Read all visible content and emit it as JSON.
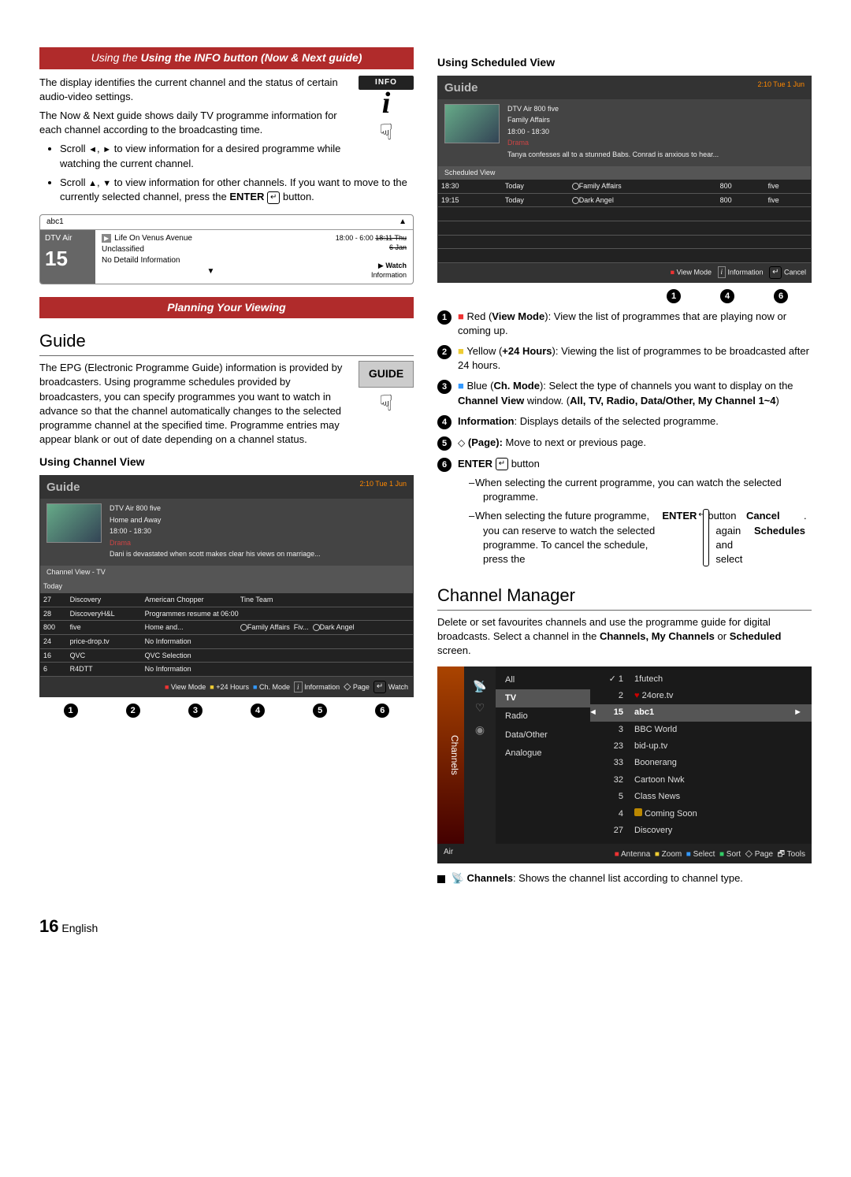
{
  "left": {
    "header1": "Using the INFO button (Now & Next guide)",
    "info_badge_label": "INFO",
    "p1": "The display identifies the current channel and the status of certain audio-video settings.",
    "p2": "The Now & Next guide shows daily TV programme information for each channel according to the broadcasting time.",
    "b1_pre": "Scroll ",
    "b1_mid": " to view information for a desired programme while watching the current channel.",
    "b2_pre": "Scroll ",
    "b2_mid": " to view information for other channels. If you want to move to the currently selected channel, press the ",
    "b2_post": " button.",
    "enter_label": "ENTER",
    "nownext": {
      "ch": "abc1",
      "src": "DTV Air",
      "num": "15",
      "prog": "Life On Venus Avenue",
      "class": "Unclassified",
      "detail": "No Detaild Information",
      "time": "18:00 - 6:00",
      "date": "18:11 Thu 6 Jan",
      "watch": "Watch",
      "info": "Information"
    },
    "header2": "Planning Your Viewing",
    "guide_heading": "Guide",
    "guide_btn": "GUIDE",
    "guide_p": "The EPG (Electronic Programme Guide) information is provided by broadcasters. Using programme schedules provided by broadcasters, you can specify programmes you want to watch in advance so that the channel automatically changes to the selected programme channel at the specified time. Programme entries may appear blank or out of date depending on a channel status.",
    "using_channel_view": "Using Channel View",
    "cvpanel": {
      "title": "Guide",
      "clock": "2:10 Tue 1 Jun",
      "meta_ch": "DTV Air 800 five",
      "meta_prog": "Home and Away",
      "meta_time": "18:00 - 18:30",
      "meta_genre": "Drama",
      "meta_desc": "Dani is devastated when scott makes clear his views on marriage...",
      "subbar": "Channel View - TV",
      "today": "Today",
      "rows": [
        {
          "n": "27",
          "c": "Discovery",
          "p": "American Chopper",
          "p2": "Tine Team"
        },
        {
          "n": "28",
          "c": "DiscoveryH&L",
          "p": "Programmes resume at 06:00",
          "p2": ""
        },
        {
          "n": "800",
          "c": "five",
          "p": "Home and...",
          "p2a": "Family Affairs",
          "p2b": "Fiv...",
          "p2c": "Dark Angel"
        },
        {
          "n": "24",
          "c": "price-drop.tv",
          "p": "No Information",
          "p2": ""
        },
        {
          "n": "16",
          "c": "QVC",
          "p": "QVC Selection",
          "p2": ""
        },
        {
          "n": "6",
          "c": "R4DTT",
          "p": "No Information",
          "p2": ""
        }
      ],
      "foot": {
        "a": "View Mode",
        "b": "+24 Hours",
        "c": "Ch. Mode",
        "d": "Information",
        "e": "Page",
        "f": "Watch"
      }
    },
    "cv_callouts": [
      "1",
      "2",
      "3",
      "4",
      "5",
      "6"
    ]
  },
  "right": {
    "using_scheduled": "Using Scheduled View",
    "svpanel": {
      "title": "Guide",
      "clock": "2:10 Tue 1 Jun",
      "meta_ch": "DTV Air 800 five",
      "meta_prog": "Family Affairs",
      "meta_time": "18:00 - 18:30",
      "meta_genre": "Drama",
      "meta_desc": "Tanya confesses all to a stunned Babs. Conrad is anxious to hear...",
      "subbar": "Scheduled View",
      "rows": [
        {
          "t": "18:30",
          "d": "Today",
          "p": "Family Affairs",
          "n": "800",
          "c": "five"
        },
        {
          "t": "19:15",
          "d": "Today",
          "p": "Dark Angel",
          "n": "800",
          "c": "five"
        }
      ],
      "foot": {
        "a": "View Mode",
        "b": "Information",
        "c": "Cancel"
      }
    },
    "sv_callouts": [
      "1",
      "4",
      "6"
    ],
    "items": {
      "i1a": "Red (",
      "i1b": "View Mode",
      "i1c": "): View the list of programmes that are playing now or coming up.",
      "i2a": "Yellow (",
      "i2b": "+24 Hours",
      "i2c": "): Viewing the list of programmes to be broadcasted after 24 hours.",
      "i3a": "Blue (",
      "i3b": "Ch. Mode",
      "i3c": "): Select the type of channels you want to display on the ",
      "i3d": "Channel View",
      "i3e": " window. (",
      "i3f": "All, TV, Radio, Data/Other, My Channel 1~4",
      "i3g": ")",
      "i4a": "Information",
      "i4b": ": Displays details of the selected programme.",
      "i5a": "(Page):",
      "i5b": " Move to next or previous page.",
      "i6a": "ENTER",
      "i6b": " button",
      "i6s1": "When selecting the current programme, you can watch the selected programme.",
      "i6s2": "When selecting the future programme, you can reserve to watch the selected programme. To cancel the schedule, press the ",
      "i6s2b": "ENTER",
      "i6s2c": " button again and select ",
      "i6s2d": "Cancel Schedules",
      "i6s2e": "."
    },
    "cm_heading": "Channel Manager",
    "cm_p1": "Delete or set favourites channels and use the programme guide for digital broadcasts. Select a channel in the ",
    "cm_p1b": "Channels, My Channels",
    "cm_p1c": " or ",
    "cm_p1d": "Scheduled",
    "cm_p1e": " screen.",
    "cmpanel": {
      "side": "Channels",
      "cats": [
        "All",
        "TV",
        "Radio",
        "Data/Other",
        "Analogue"
      ],
      "list": [
        {
          "n": "1",
          "c": "1futech",
          "pre": "✓"
        },
        {
          "n": "2",
          "c": "24ore.tv",
          "pre": "♥"
        },
        {
          "n": "15",
          "c": "abc1",
          "pre": ""
        },
        {
          "n": "3",
          "c": "BBC World",
          "pre": ""
        },
        {
          "n": "23",
          "c": "bid-up.tv",
          "pre": ""
        },
        {
          "n": "33",
          "c": "Boonerang",
          "pre": ""
        },
        {
          "n": "32",
          "c": "Cartoon Nwk",
          "pre": ""
        },
        {
          "n": "5",
          "c": "Class News",
          "pre": ""
        },
        {
          "n": "4",
          "c": "Coming Soon",
          "pre": "lock"
        },
        {
          "n": "27",
          "c": "Discovery",
          "pre": ""
        }
      ],
      "footL": "Air",
      "footR": {
        "a": "Antenna",
        "b": "Zoom",
        "c": "Select",
        "d": "Sort",
        "e": "Page",
        "f": "Tools"
      }
    },
    "cm_b1a": "Channels",
    "cm_b1b": ": Shows the channel list according to channel type."
  },
  "footer": {
    "page": "16",
    "lang": "English"
  }
}
